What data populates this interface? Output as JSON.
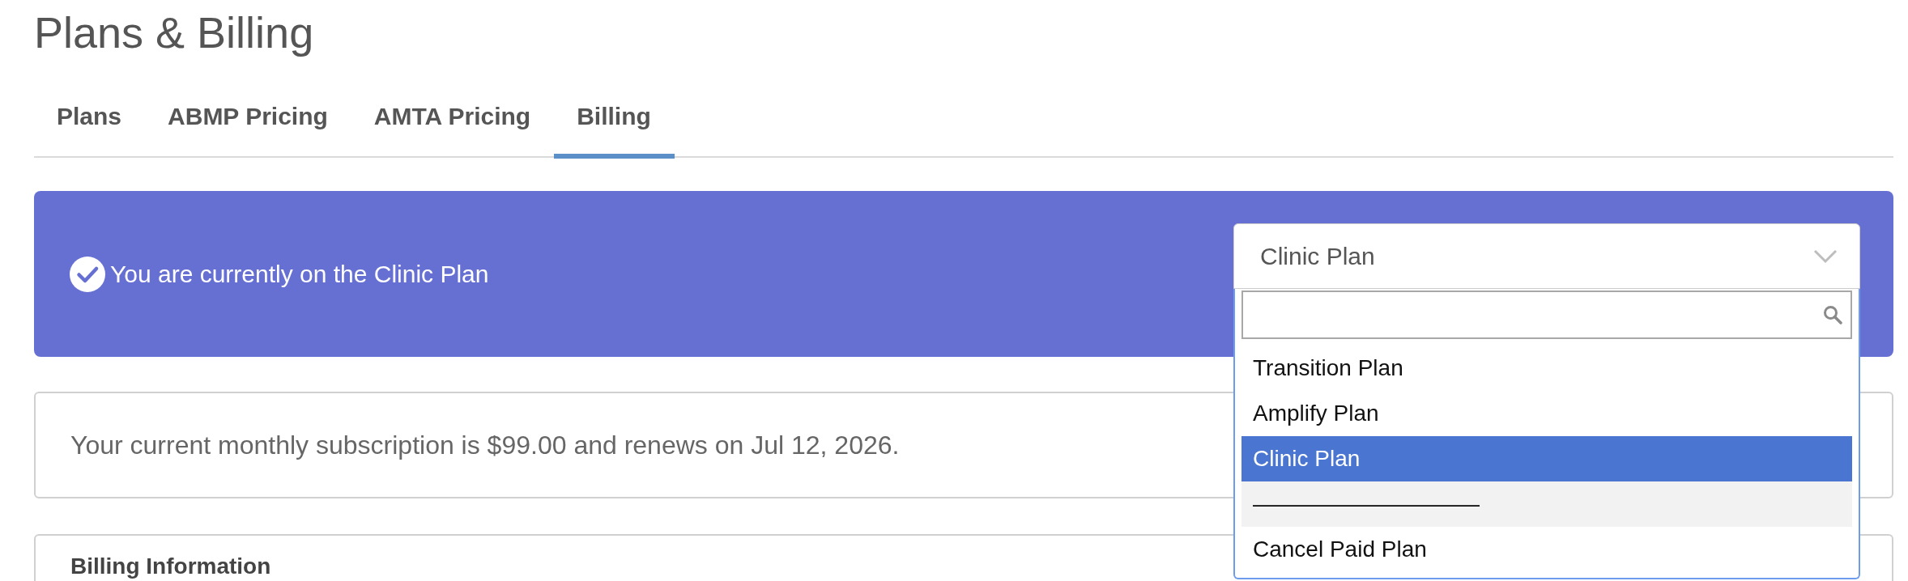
{
  "page": {
    "title": "Plans & Billing"
  },
  "tabs": [
    {
      "label": "Plans",
      "selected": false
    },
    {
      "label": "ABMP Pricing",
      "selected": false
    },
    {
      "label": "AMTA Pricing",
      "selected": false
    },
    {
      "label": "Billing",
      "selected": true
    }
  ],
  "banner": {
    "message": "You are currently on the Clinic Plan",
    "plan_select": {
      "value": "Clinic Plan",
      "expanded": true,
      "options": [
        {
          "label": "Transition Plan",
          "selected": false,
          "disabled": false
        },
        {
          "label": "Amplify Plan",
          "selected": false,
          "disabled": false
        },
        {
          "label": "Clinic Plan",
          "selected": true,
          "disabled": false
        },
        {
          "label": "——————————",
          "selected": false,
          "disabled": true
        },
        {
          "label": "Cancel Paid Plan",
          "selected": false,
          "disabled": false
        }
      ]
    }
  },
  "subscription": {
    "text": "Your current monthly subscription is $99.00 and renews on Jul 12, 2026."
  },
  "billing": {
    "heading": "Billing Information"
  }
}
